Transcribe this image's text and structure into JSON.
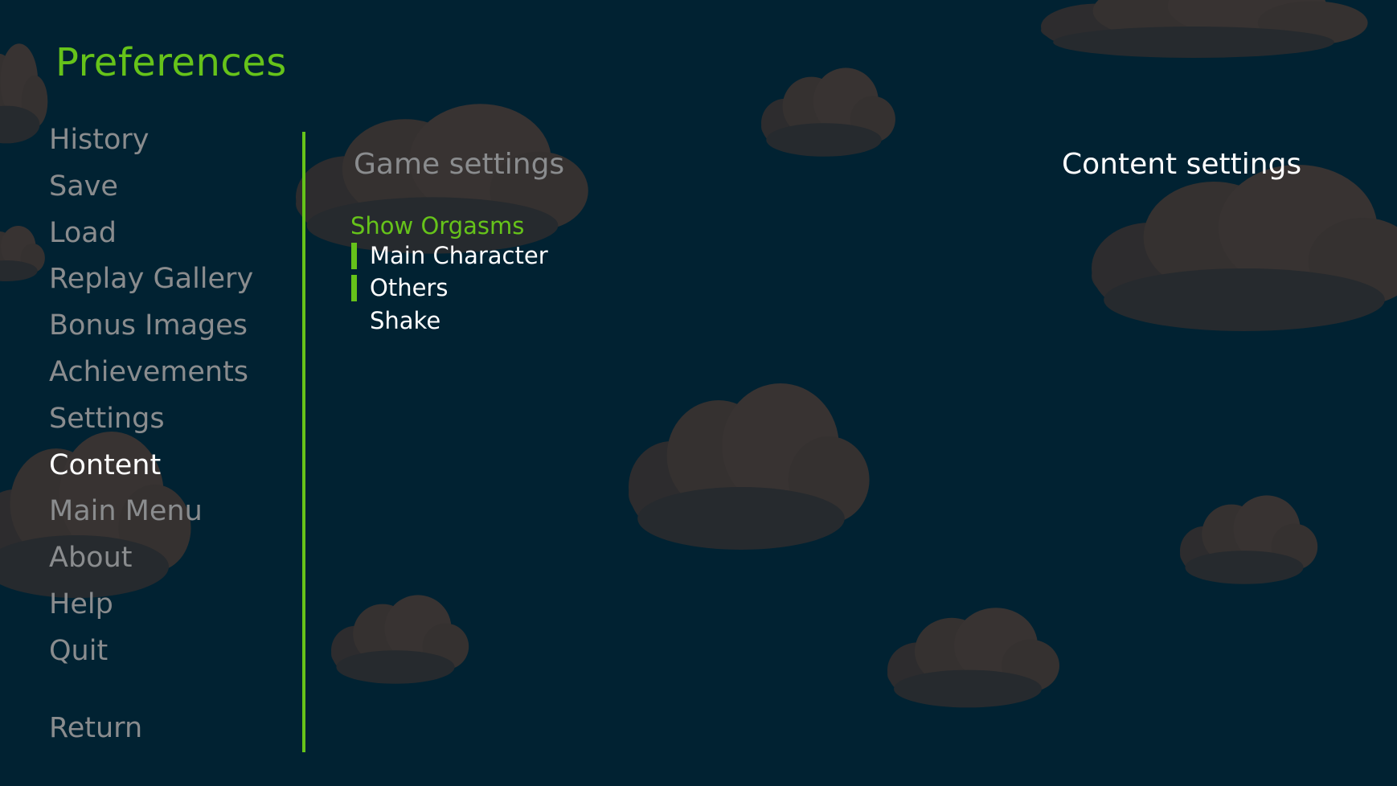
{
  "screen": {
    "title": "Preferences",
    "colors": {
      "accent": "#66c31a",
      "background": "#012232",
      "muted_text": "#8a8c8e",
      "active_text": "#ffffff",
      "cloud": "#34302f"
    }
  },
  "nav": {
    "items": [
      {
        "label": "History",
        "active": false
      },
      {
        "label": "Save",
        "active": false
      },
      {
        "label": "Load",
        "active": false
      },
      {
        "label": "Replay Gallery",
        "active": false
      },
      {
        "label": "Bonus Images",
        "active": false
      },
      {
        "label": "Achievements",
        "active": false
      },
      {
        "label": "Settings",
        "active": false
      },
      {
        "label": "Content",
        "active": true
      },
      {
        "label": "Main Menu",
        "active": false
      },
      {
        "label": "About",
        "active": false
      },
      {
        "label": "Help",
        "active": false
      },
      {
        "label": "Quit",
        "active": false
      }
    ],
    "return_label": "Return"
  },
  "sections": {
    "game_settings_label": "Game settings",
    "content_settings_label": "Content settings",
    "active_section": "Content settings"
  },
  "content": {
    "group_label": "Show Orgasms",
    "options": [
      {
        "label": "Main Character",
        "selected": true
      },
      {
        "label": "Others",
        "selected": true
      },
      {
        "label": "Shake",
        "selected": false
      }
    ]
  }
}
